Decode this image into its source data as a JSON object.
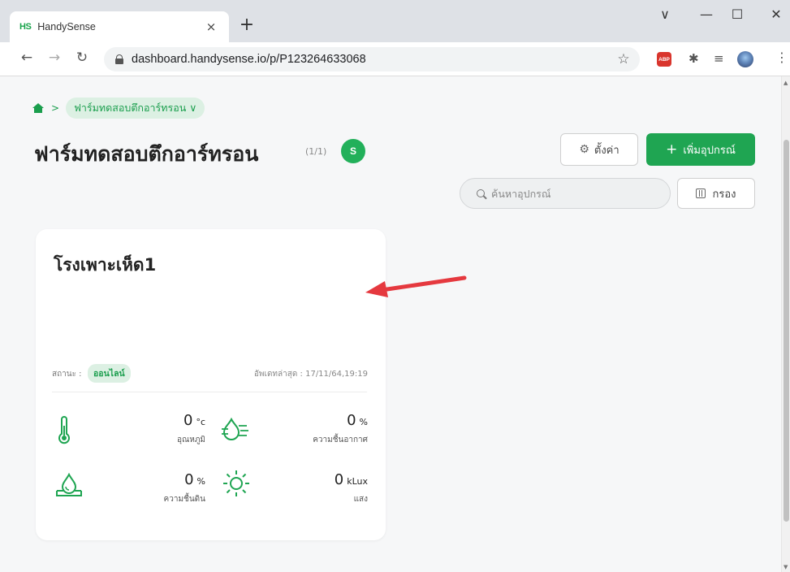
{
  "browser": {
    "tab_favicon_text": "HS",
    "tab_title": "HandySense",
    "tab_close": "×",
    "new_tab": "+",
    "url": "dashboard.handysense.io/p/P123264633068",
    "ext_abp": "ABP"
  },
  "breadcrumb": {
    "separator": ">",
    "farm": "ฟาร์มทดสอบตึกอาร์ทรอน ∨"
  },
  "header": {
    "title": "ฟาร์มทดสอบตึกอาร์ทรอน",
    "count": "(1/1)",
    "avatar_initial": "S",
    "settings_label": "ตั้งค่า",
    "add_label": "เพิ่มอุปกรณ์",
    "search_placeholder": "ค้นหาอุปกรณ์",
    "filter_label": "กรอง"
  },
  "device": {
    "name": "โรงเพาะเห็ด1",
    "status_label": "สถานะ :",
    "status": "ออนไลน์",
    "updated": "อัพเดทล่าสุด : 17/11/64,19:19",
    "sensors": [
      {
        "value": "0",
        "unit": "°c",
        "label": "อุณหภูมิ",
        "icon": "thermometer-icon"
      },
      {
        "value": "0",
        "unit": "%",
        "label": "ความชื้นอากาศ",
        "icon": "air-humidity-icon"
      },
      {
        "value": "0",
        "unit": "%",
        "label": "ความชื้นดิน",
        "icon": "soil-moisture-icon"
      },
      {
        "value": "0",
        "unit": "kLux",
        "label": "แสง",
        "icon": "sun-icon"
      }
    ]
  },
  "colors": {
    "brand_green": "#1fa552",
    "accent_green": "#1a9e4d",
    "badge_bg": "#dcf0e3",
    "annotation_arrow": "#e5393f"
  }
}
